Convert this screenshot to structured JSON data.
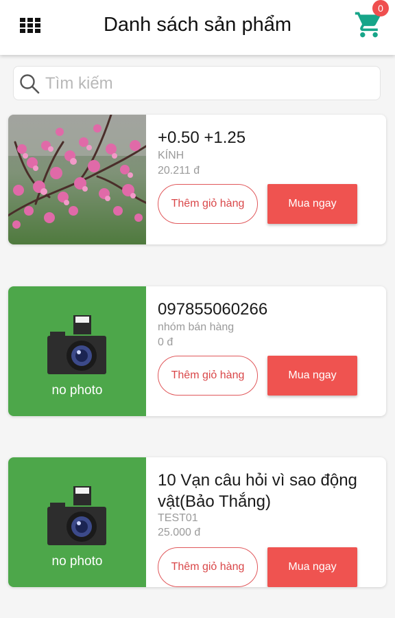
{
  "header": {
    "title": "Danh sách sản phẩm",
    "cart_count": "0",
    "accent_color": "#17a589"
  },
  "search": {
    "placeholder": "Tìm kiếm",
    "value": ""
  },
  "products": [
    {
      "name": "+0.50 +1.25",
      "category": "KÍNH",
      "price": "20.211 đ",
      "image": "peach-blossom-photo",
      "add_label": "Thêm giỏ hàng",
      "buy_label": "Mua ngay"
    },
    {
      "name": "097855060266",
      "category": " nhóm bán hàng",
      "price": "0 đ",
      "image": "no-photo",
      "no_photo_label": "no photo",
      "add_label": "Thêm giỏ hàng",
      "buy_label": "Mua ngay"
    },
    {
      "name": "10 Vạn câu hỏi vì sao động vật(Bảo Thắng)",
      "category": "TEST01",
      "price": "25.000 đ",
      "image": "no-photo",
      "no_photo_label": "no photo",
      "add_label": "Thêm giỏ hàng",
      "buy_label": "Mua ngay"
    }
  ],
  "colors": {
    "buy_button": "#ef5350",
    "add_button_border": "#e0575a",
    "no_photo_bg": "#4da74a",
    "badge": "#ef4f4f"
  }
}
